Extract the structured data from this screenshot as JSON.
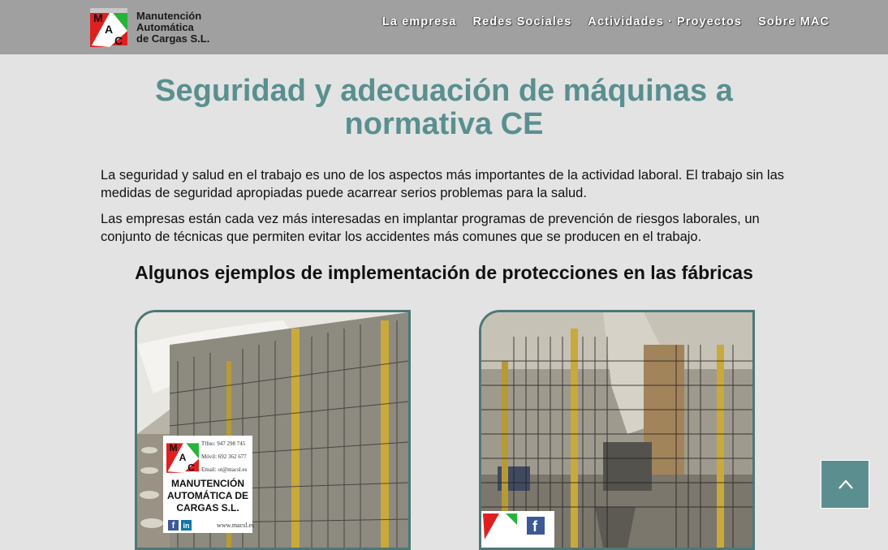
{
  "header": {
    "logo_lines": [
      "Manutención",
      "Automática",
      "de Cargas S.L."
    ],
    "logo_mark_letters": [
      "M",
      "A",
      "C"
    ],
    "nav": [
      {
        "label": "La empresa"
      },
      {
        "label": "Redes Sociales"
      },
      {
        "label": "Actividades · Proyectos"
      },
      {
        "label": "Sobre MAC"
      }
    ]
  },
  "main": {
    "title": "Seguridad y adecuación de máquinas a normativa CE",
    "paragraphs": [
      "La seguridad y salud en el trabajo es uno de los aspectos más importantes de la actividad laboral. El trabajo sin las medidas de seguridad apropiadas puede acarrear serios problemas para la salud.",
      "Las empresas están cada vez más interesadas en implantar programas de prevención de riesgos laborales, un conjunto de técnicas que permiten evitar los accidentes más comunes que se producen en el trabajo."
    ],
    "subtitle": "Algunos ejemplos de implementación de protecciones en las fábricas"
  },
  "gallery": {
    "watermark": {
      "company": "MANUTENCIÓN AUTOMÁTICA DE CARGAS S.L.",
      "phone": "Tlfno: 947 298 745",
      "mobile": "Móvil: 692 362 677",
      "email": "Email: ot@macsl.es",
      "web": "www.macsl.es"
    }
  },
  "colors": {
    "accent": "#5a8f8f",
    "topbar": "#a0a0a0",
    "background": "#e3e3e3"
  },
  "icons": {
    "scroll_top": "chevron-up-icon"
  }
}
